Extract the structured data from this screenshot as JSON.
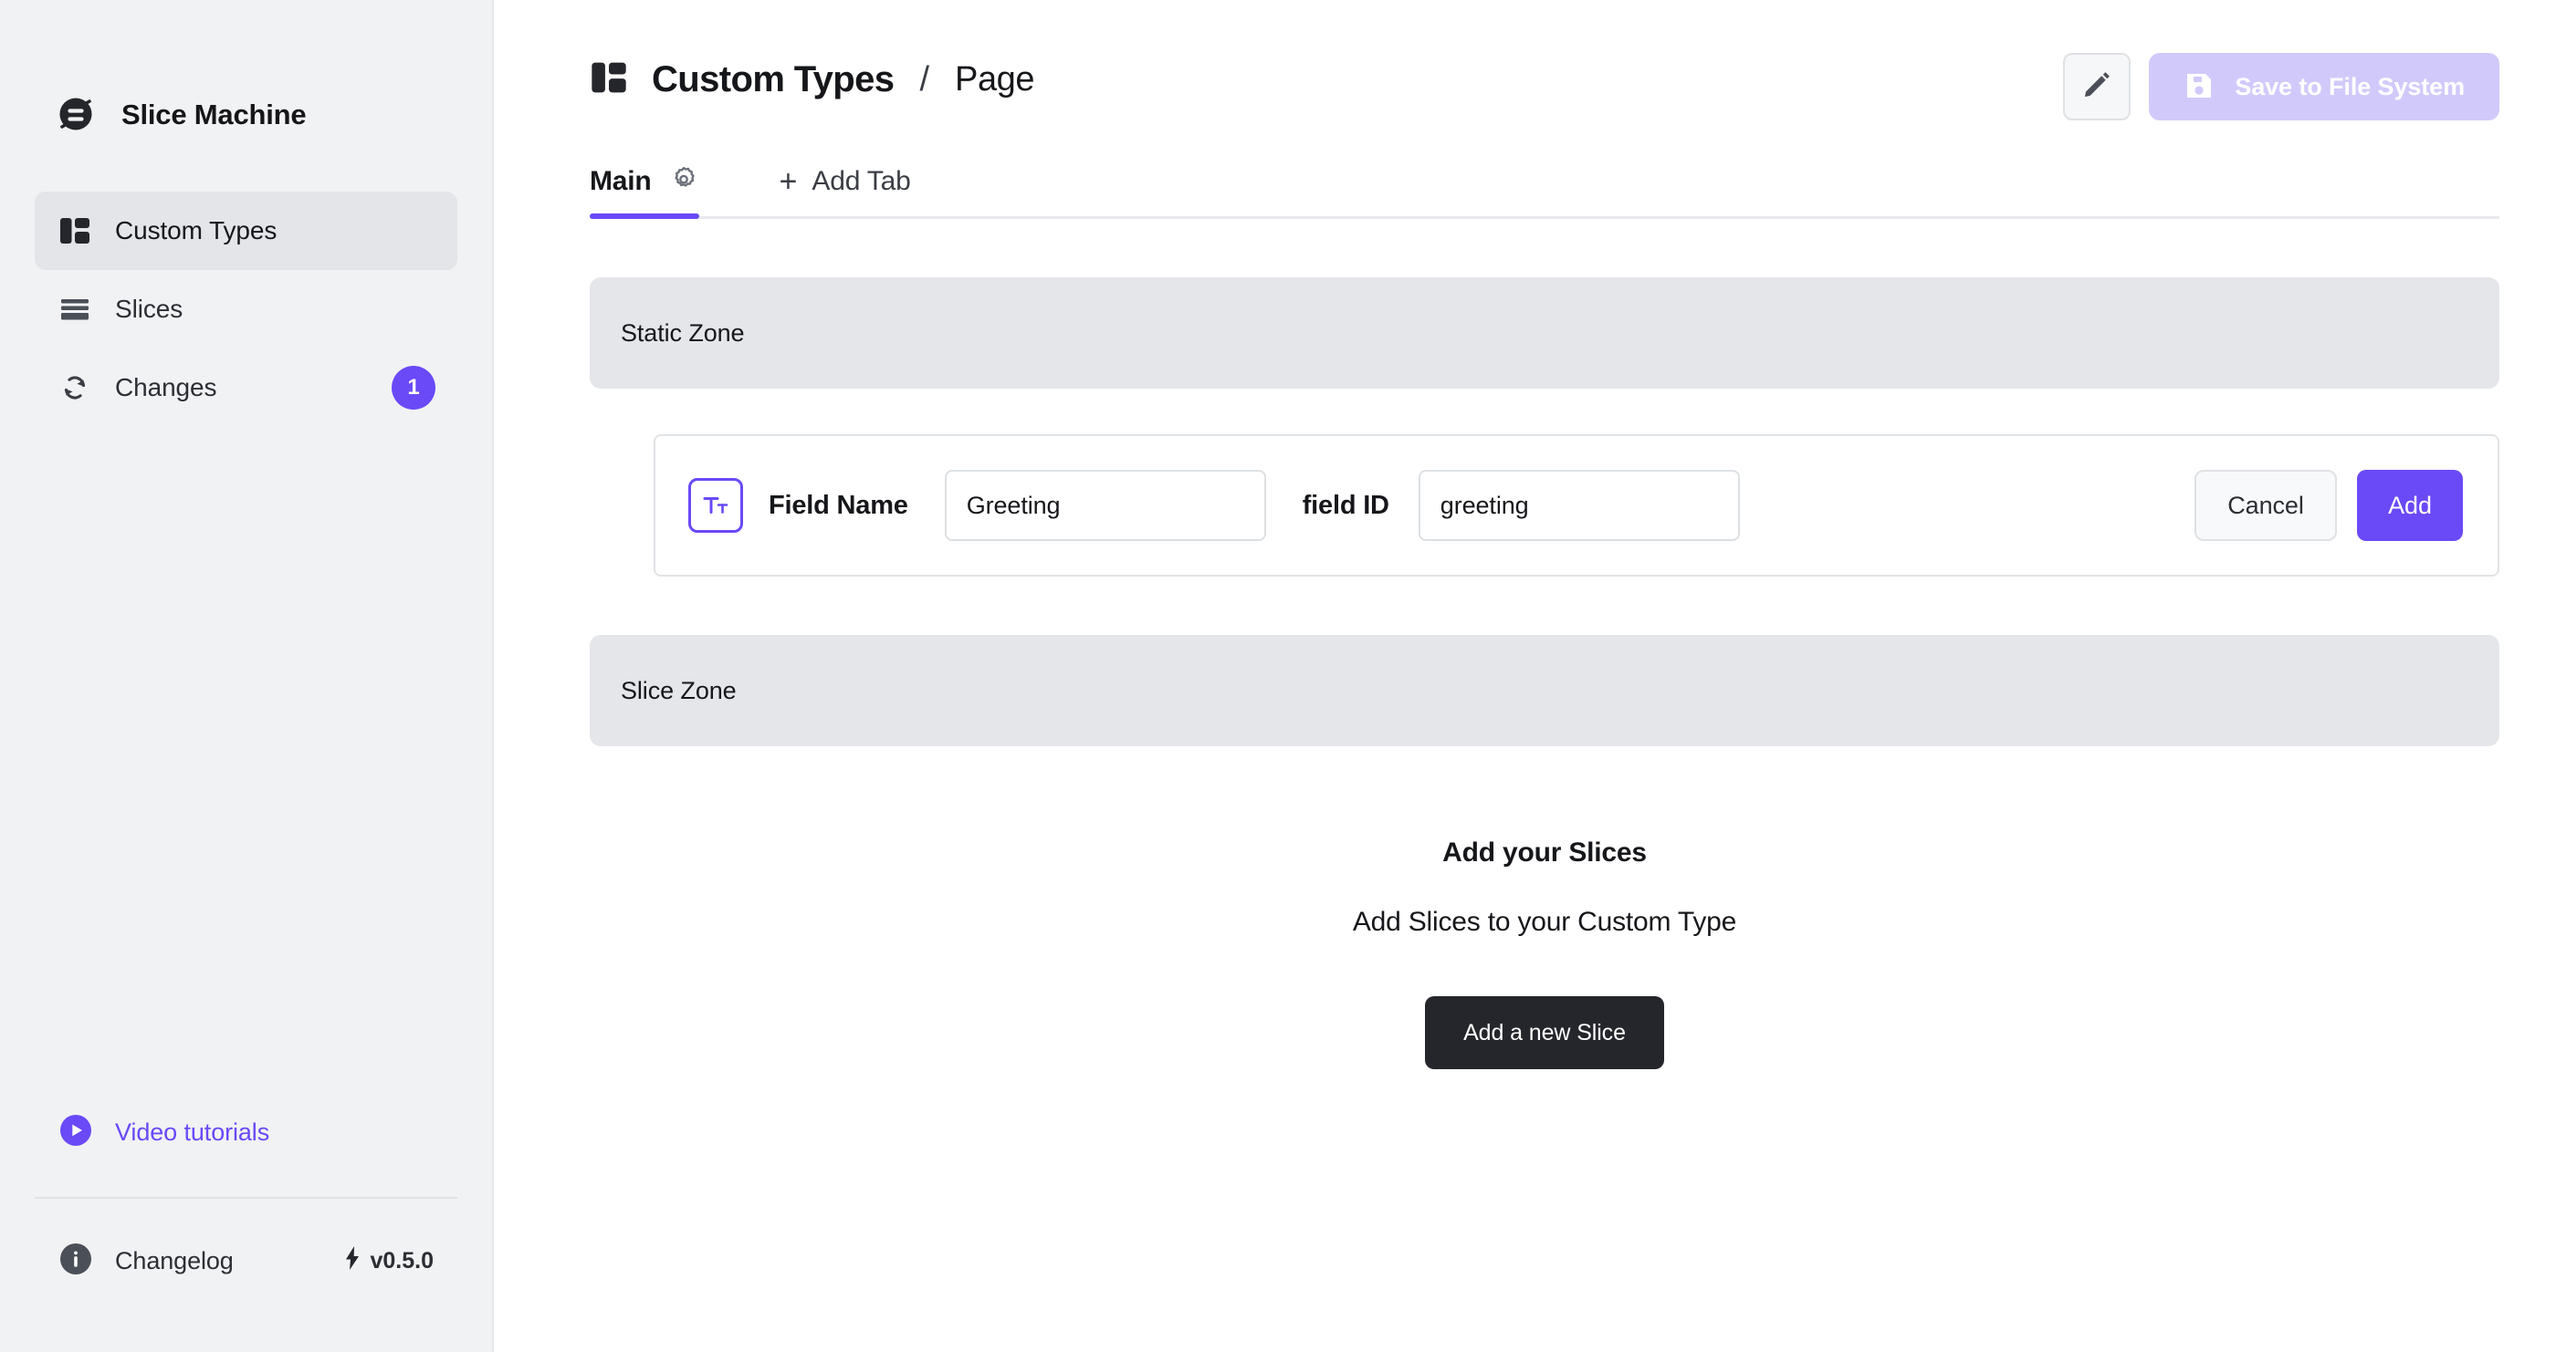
{
  "app": {
    "brand_name": "Slice Machine",
    "accent_color": "#6A49F7",
    "accent_disabled_color": "#D2C9FB",
    "dark_color": "#25262B"
  },
  "sidebar": {
    "items": [
      {
        "label": "Custom Types",
        "icon": "layout-icon",
        "active": true,
        "badge": null
      },
      {
        "label": "Slices",
        "icon": "stack-icon",
        "active": false,
        "badge": null
      },
      {
        "label": "Changes",
        "icon": "refresh-icon",
        "active": false,
        "badge": "1"
      }
    ],
    "tutorials_label": "Video tutorials",
    "changelog_label": "Changelog",
    "version": "v0.5.0"
  },
  "header": {
    "breadcrumb_root": "Custom Types",
    "breadcrumb_separator": "/",
    "breadcrumb_current": "Page",
    "edit_icon": "pencil-icon",
    "save_label": "Save to File System",
    "save_icon": "floppy-disk-icon"
  },
  "tabs": {
    "items": [
      {
        "label": "Main",
        "active": true,
        "icon": "gear-icon"
      }
    ],
    "add_plus": "+",
    "add_label": "Add Tab"
  },
  "static_zone": {
    "title": "Static Zone",
    "field": {
      "type_icon_label": "Tt",
      "name_label": "Field Name",
      "name_value": "Greeting",
      "name_placeholder": "Field Name",
      "id_label": "field ID",
      "id_value": "greeting",
      "id_placeholder": "field ID",
      "cancel_label": "Cancel",
      "add_label": "Add"
    }
  },
  "slice_zone": {
    "title": "Slice Zone",
    "empty_title": "Add your Slices",
    "empty_subtitle": "Add Slices to your Custom Type",
    "add_slice_label": "Add a new Slice"
  }
}
